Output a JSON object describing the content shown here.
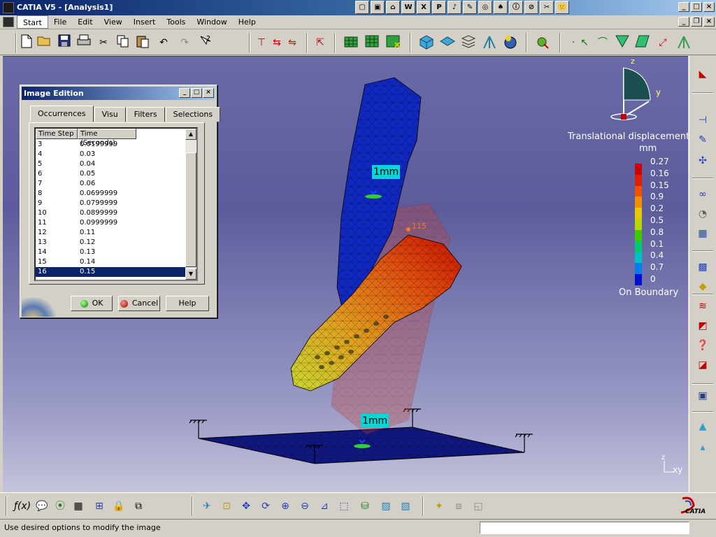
{
  "window": {
    "title": "CATIA V5 - [Analysis1]"
  },
  "quick_icons": [
    "▢",
    "▣",
    "⌂",
    "W",
    "X",
    "P",
    "♪",
    "✎",
    "◎",
    "♠",
    "ⓘ",
    "⊘",
    "✂",
    "🙂"
  ],
  "menubar": {
    "items": [
      {
        "label": "Start",
        "active": true
      },
      {
        "label": "File"
      },
      {
        "label": "Edit"
      },
      {
        "label": "View"
      },
      {
        "label": "Insert"
      },
      {
        "label": "Tools"
      },
      {
        "label": "Window"
      },
      {
        "label": "Help"
      }
    ]
  },
  "dialog": {
    "title": "Image Edition",
    "tabs": [
      "Occurrences",
      "Visu",
      "Filters",
      "Selections"
    ],
    "columns": [
      "Time Step",
      "Time (Seconds)"
    ],
    "rows": [
      {
        "step": "3",
        "time": "0.0199999"
      },
      {
        "step": "4",
        "time": "0.03"
      },
      {
        "step": "5",
        "time": "0.04"
      },
      {
        "step": "6",
        "time": "0.05"
      },
      {
        "step": "7",
        "time": "0.06"
      },
      {
        "step": "8",
        "time": "0.0699999"
      },
      {
        "step": "9",
        "time": "0.0799999"
      },
      {
        "step": "10",
        "time": "0.0899999"
      },
      {
        "step": "11",
        "time": "0.0999999"
      },
      {
        "step": "12",
        "time": "0.11"
      },
      {
        "step": "13",
        "time": "0.12"
      },
      {
        "step": "14",
        "time": "0.13"
      },
      {
        "step": "15",
        "time": "0.14"
      },
      {
        "step": "16",
        "time": "0.15",
        "selected": true
      }
    ],
    "buttons": {
      "ok": "OK",
      "cancel": "Cancel",
      "help": "Help"
    }
  },
  "legend": {
    "title": "Translational displacement m",
    "unit": "mm",
    "values": [
      "0.27",
      "0.16",
      "0.15",
      "0.9",
      "0.2",
      "0.5",
      "0.8",
      "0.1",
      "0.4",
      "0.7",
      "0"
    ],
    "colors": [
      "#d00000",
      "#e02000",
      "#f05000",
      "#f09000",
      "#e8c800",
      "#b8d800",
      "#40c800",
      "#00c870",
      "#00c0c0",
      "#0080f0",
      "#0010d0"
    ],
    "boundary_label": "On Boundary"
  },
  "viewport": {
    "mesh_tag_upper": "1mm",
    "mesh_tag_lower": "1mm",
    "compass_z": "z",
    "compass_y": "y",
    "axis_z": "z",
    "axis_xy": "xy",
    "point_marker": "115"
  },
  "status": {
    "text": "Use desired options to modify the image"
  },
  "brand": {
    "logo_text": "CATIA"
  }
}
